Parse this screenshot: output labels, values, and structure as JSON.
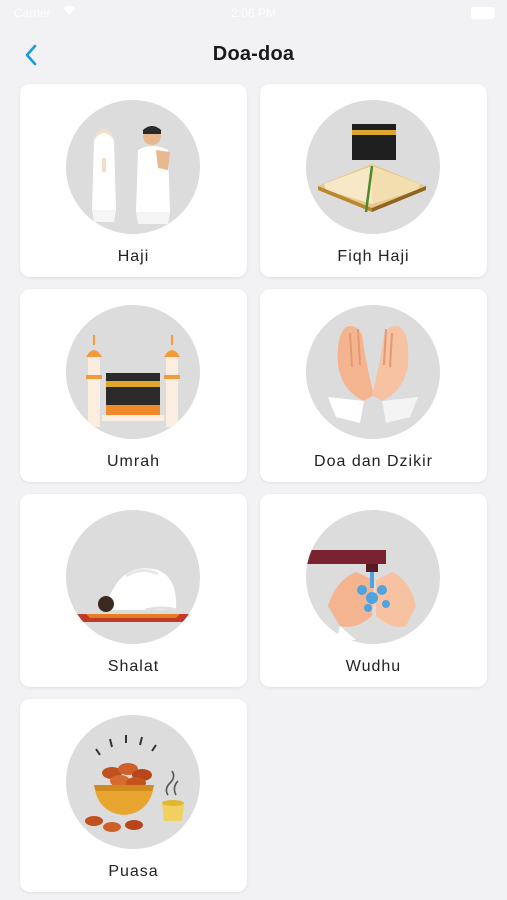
{
  "status_bar": {
    "carrier": "Carrier",
    "time": "2:06 PM"
  },
  "header": {
    "title": "Doa-doa"
  },
  "menu": [
    {
      "label": "Haji",
      "icon": "hajj-pilgrims-icon"
    },
    {
      "label": "Fiqh Haji",
      "icon": "kaaba-book-icon"
    },
    {
      "label": "Umrah",
      "icon": "kaaba-minarets-icon"
    },
    {
      "label": "Doa dan Dzikir",
      "icon": "praying-hands-icon"
    },
    {
      "label": "Shalat",
      "icon": "prostration-icon"
    },
    {
      "label": "Wudhu",
      "icon": "ablution-icon"
    },
    {
      "label": "Puasa",
      "icon": "dates-bowl-icon"
    }
  ],
  "colors": {
    "accent": "#1a9be0",
    "background": "#f2f2f4",
    "card": "#ffffff",
    "circle": "#dcdcdc"
  }
}
